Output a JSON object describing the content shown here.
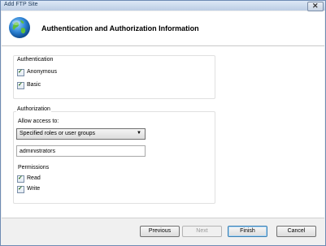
{
  "window": {
    "title": "Add FTP Site",
    "close_glyph": "✕"
  },
  "header": {
    "heading": "Authentication and Authorization Information",
    "icon": "globe-icon"
  },
  "authentication": {
    "title": "Authentication",
    "options": [
      {
        "label": "Anonymous",
        "checked": true
      },
      {
        "label": "Basic",
        "checked": true
      }
    ]
  },
  "authorization": {
    "title": "Authorization",
    "allow_access_label": "Allow access to:",
    "allow_access_selected": "Specified roles or user groups",
    "users_field_value": "administrators",
    "permissions_title": "Permissions",
    "permissions": [
      {
        "label": "Read",
        "checked": true
      },
      {
        "label": "Write",
        "checked": true
      }
    ]
  },
  "buttons": {
    "previous": "Previous",
    "next": "Next",
    "finish": "Finish",
    "cancel": "Cancel"
  },
  "colors": {
    "accent": "#3c7fb1",
    "check": "#2b6a20"
  }
}
